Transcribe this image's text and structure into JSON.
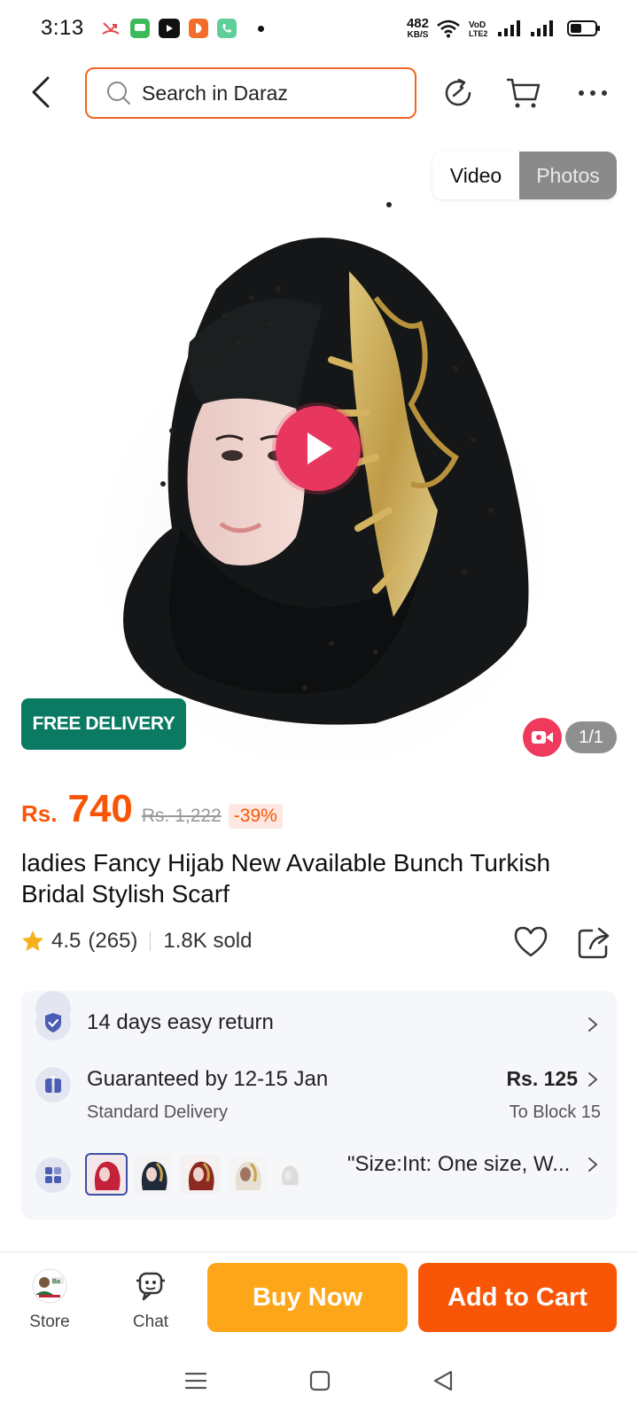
{
  "status_bar": {
    "time": "3:13",
    "net_speed": "482",
    "net_speed_unit": "KB/S",
    "volte": "Vo0 LTE2"
  },
  "header": {
    "search_placeholder": "Search in Daraz"
  },
  "gallery": {
    "tab_video": "Video",
    "tab_photos": "Photos",
    "active_tab": "Video",
    "badge": "FREE DELIVERY",
    "counter": "1/1"
  },
  "product": {
    "currency": "Rs.",
    "price": "740",
    "original_price": "Rs. 1,222",
    "discount": "-39%",
    "title": "ladies Fancy Hijab New Available Bunch Turkish Bridal Stylish Scarf",
    "rating": "4.5",
    "reviews": "(265)",
    "sold": "1.8K sold"
  },
  "info": {
    "returns": "14 days easy return",
    "delivery_main": "Guaranteed by 12-15 Jan",
    "delivery_sub": "Standard Delivery",
    "delivery_price": "Rs. 125",
    "delivery_location": "To Block 15",
    "variant_text": "\"Size:Int: One size, W..."
  },
  "bottom_bar": {
    "store_label": "Store",
    "chat_label": "Chat",
    "buy_now": "Buy Now",
    "add_to_cart": "Add to Cart"
  },
  "colors": {
    "brand_orange": "#f85606",
    "buy_now": "#fea619",
    "free_delivery": "#0b7a62",
    "play": "#e8375e"
  }
}
